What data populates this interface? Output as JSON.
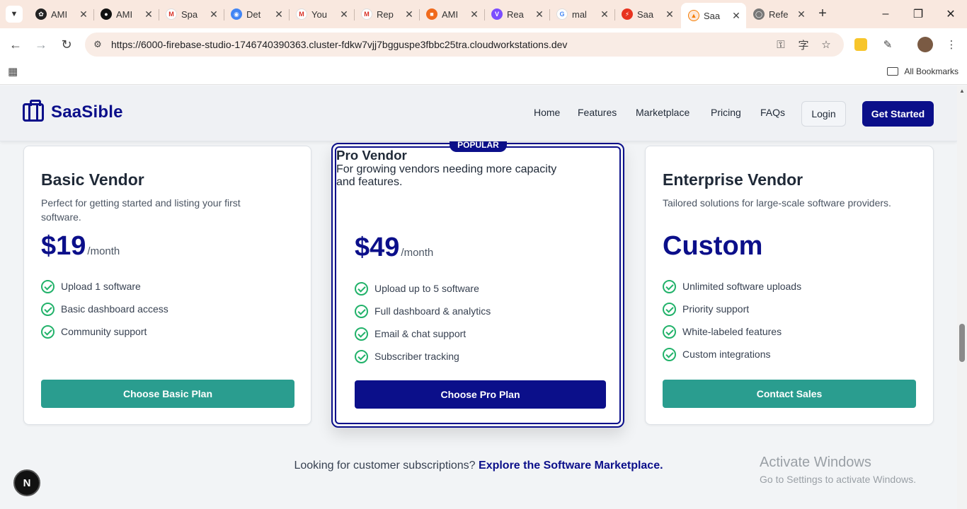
{
  "browser": {
    "tabs": [
      {
        "label": "AMI",
        "favicon": "chatgpt-icon",
        "color": "#222222"
      },
      {
        "label": "AMI",
        "favicon": "github-icon",
        "color": "#111111"
      },
      {
        "label": "Spa",
        "favicon": "gmail-icon",
        "color": "#d93025"
      },
      {
        "label": "Det",
        "favicon": "chrome-icon",
        "color": "#4285f4"
      },
      {
        "label": "You",
        "favicon": "gmail-icon",
        "color": "#d93025"
      },
      {
        "label": "Rep",
        "favicon": "gmail-icon",
        "color": "#d93025"
      },
      {
        "label": "AMI",
        "favicon": "app-icon",
        "color": "#f06a1c"
      },
      {
        "label": "Rea",
        "favicon": "vite-icon",
        "color": "#7c4dff"
      },
      {
        "label": "mal",
        "favicon": "google-icon",
        "color": "#4285f4"
      },
      {
        "label": "Saa",
        "favicon": "bolt-icon",
        "color": "#e8331f"
      },
      {
        "label": "Saa",
        "favicon": "firebase-icon",
        "color": "#f57c00"
      },
      {
        "label": "Refe",
        "favicon": "globe-icon",
        "color": "#555555"
      }
    ],
    "active_tab_index": 10,
    "url": "https://6000-firebase-studio-1746740390363.cluster-fdkw7vjj7bgguspe3fbbc25tra.cloudworkstations.dev",
    "bookmarks_label": "All Bookmarks"
  },
  "site": {
    "brand": "SaaSible",
    "nav": [
      "Home",
      "Features",
      "Marketplace",
      "Pricing",
      "FAQs"
    ],
    "login_label": "Login",
    "get_started_label": "Get Started"
  },
  "plans": [
    {
      "name": "Basic Vendor",
      "description": "Perfect for getting started and listing your first software.",
      "price": "$19",
      "period": "/month",
      "features": [
        "Upload 1 software",
        "Basic dashboard access",
        "Community support"
      ],
      "button": "Choose Basic Plan",
      "button_color": "#2a9d8f"
    },
    {
      "name": "Pro Vendor",
      "badge": "POPULAR",
      "description": "For growing vendors needing more capacity and features.",
      "price": "$49",
      "period": "/month",
      "features": [
        "Upload up to 5 software",
        "Full dashboard & analytics",
        "Email & chat support",
        "Subscriber tracking"
      ],
      "button": "Choose Pro Plan",
      "button_color": "#0b0f8a"
    },
    {
      "name": "Enterprise Vendor",
      "description": "Tailored solutions for large-scale software providers.",
      "price": "Custom",
      "features": [
        "Unlimited software uploads",
        "Priority support",
        "White-labeled features",
        "Custom integrations"
      ],
      "button": "Contact Sales",
      "button_color": "#2a9d8f"
    }
  ],
  "footer": {
    "text": "Looking for customer subscriptions?",
    "link": "Explore the Software Marketplace."
  },
  "dev_badge": "N",
  "watermark": {
    "line1": "Activate Windows",
    "line2": "Go to Settings to activate Windows."
  },
  "colors": {
    "brand": "#0b0f8a",
    "accent_teal": "#2a9d8f",
    "check_green": "#22b26a"
  }
}
